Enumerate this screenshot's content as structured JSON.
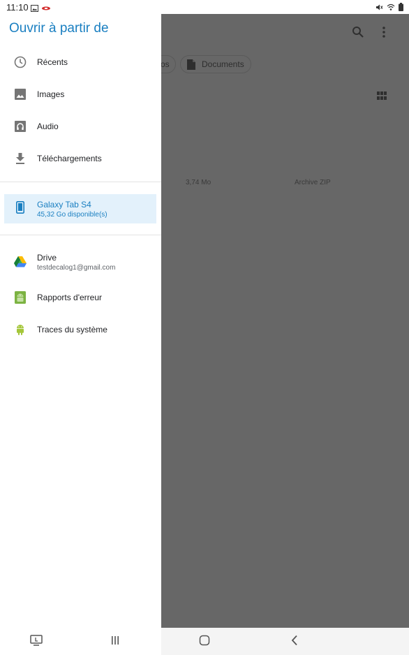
{
  "status_bar": {
    "time": "11:10"
  },
  "drawer": {
    "title": "Ouvrir à partir de",
    "roots": [
      {
        "label": "Récents",
        "icon": "clock-icon"
      },
      {
        "label": "Images",
        "icon": "image-icon"
      },
      {
        "label": "Audio",
        "icon": "audio-icon"
      },
      {
        "label": "Téléchargements",
        "icon": "download-icon"
      }
    ],
    "device": {
      "label": "Galaxy Tab S4",
      "sub": "45,32 Go disponible(s)",
      "icon": "tablet-icon"
    },
    "services": [
      {
        "label": "Drive",
        "sub": "testdecalog1@gmail.com",
        "icon": "drive-icon"
      },
      {
        "label": "Rapports d'erreur",
        "icon": "android-icon"
      },
      {
        "label": "Traces du système",
        "icon": "android-small-icon"
      }
    ]
  },
  "background": {
    "chip_partial": "os",
    "chip_documents": "Documents",
    "file_size": "3,74 Mo",
    "file_type": "Archive ZIP"
  },
  "colors": {
    "accent": "#1a7fc1",
    "selected_bg": "#e3f1fb",
    "scrim": "#676767"
  }
}
